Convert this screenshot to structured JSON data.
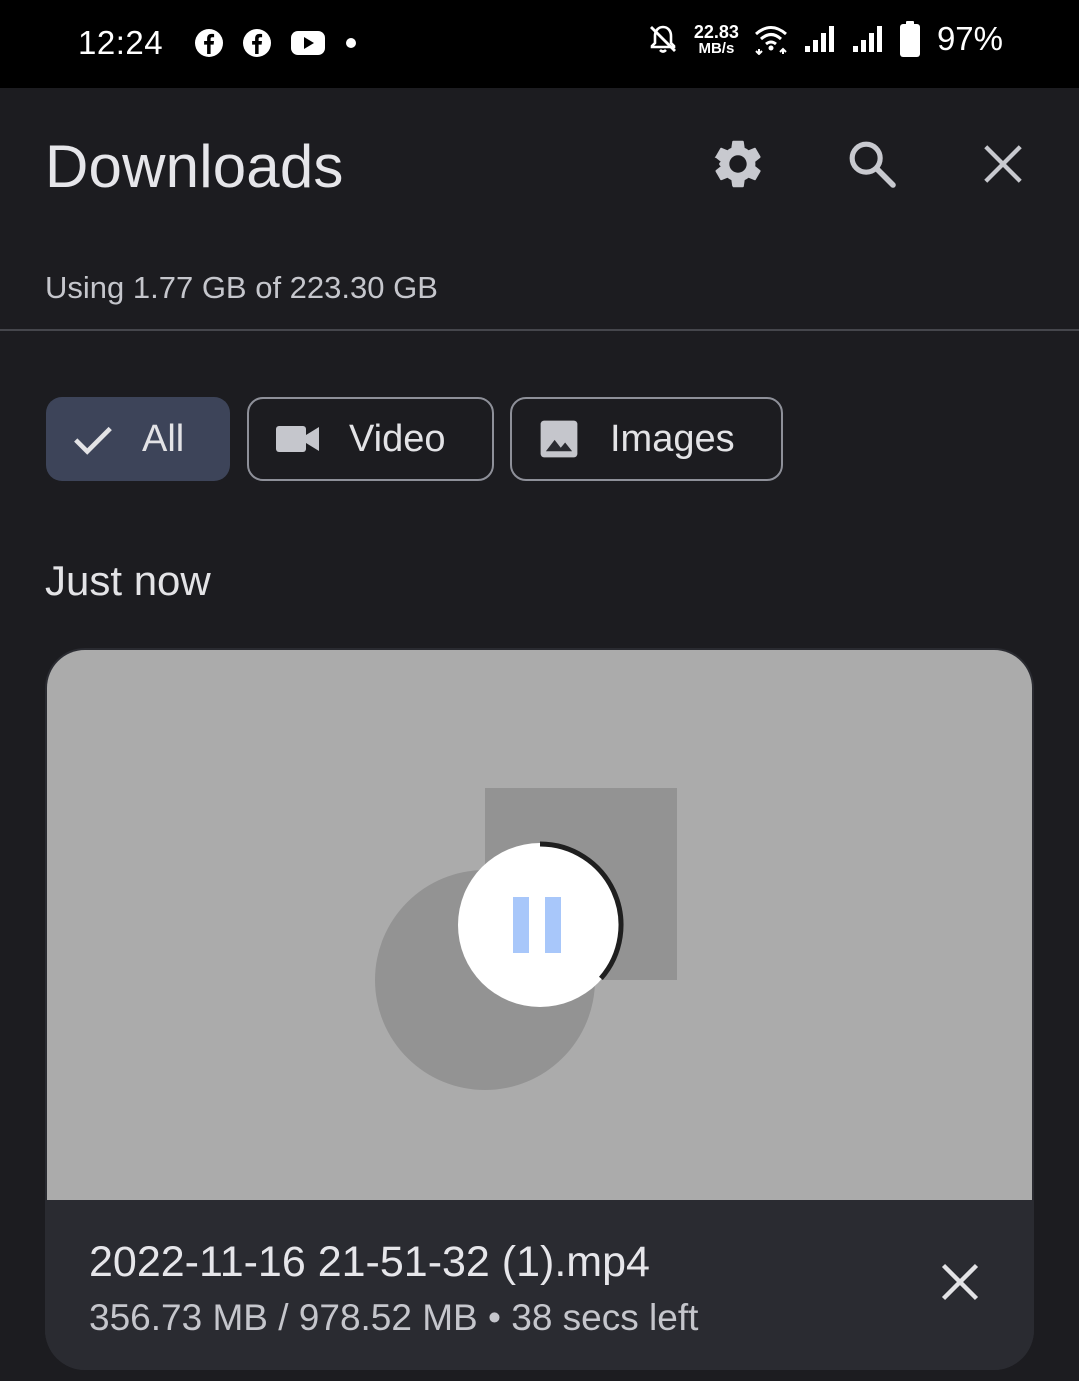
{
  "status_bar": {
    "time": "12:24",
    "net_speed_value": "22.83",
    "net_speed_unit": "MB/s",
    "battery_percent": "97%",
    "left_icons": [
      "facebook-icon",
      "facebook-icon",
      "youtube-icon",
      "dot-icon"
    ],
    "right_icons": [
      "notifications-off-icon",
      "wifi-icon",
      "signal-icon",
      "signal-icon",
      "battery-icon"
    ]
  },
  "header": {
    "title": "Downloads",
    "settings_icon": "gear-icon",
    "search_icon": "search-icon",
    "close_icon": "close-icon"
  },
  "storage": {
    "text": "Using 1.77 GB of 223.30 GB"
  },
  "filters": [
    {
      "label": "All",
      "icon": "check-icon",
      "selected": true
    },
    {
      "label": "Video",
      "icon": "video-camera-icon",
      "selected": false
    },
    {
      "label": "Images",
      "icon": "image-icon",
      "selected": false
    }
  ],
  "section": {
    "label": "Just now"
  },
  "download_item": {
    "file_name": "2022-11-16 21-51-32 (1).mp4",
    "progress_text": "356.73 MB / 978.52 MB • 38 secs left",
    "progress_fraction": 0.3646,
    "state": "downloading",
    "pause_icon": "pause-icon",
    "cancel_icon": "close-icon"
  },
  "colors": {
    "background": "#1c1c20",
    "selected_chip": "#3d4459",
    "accent": "#a8c7fa",
    "thumbnail": "#ababab"
  }
}
